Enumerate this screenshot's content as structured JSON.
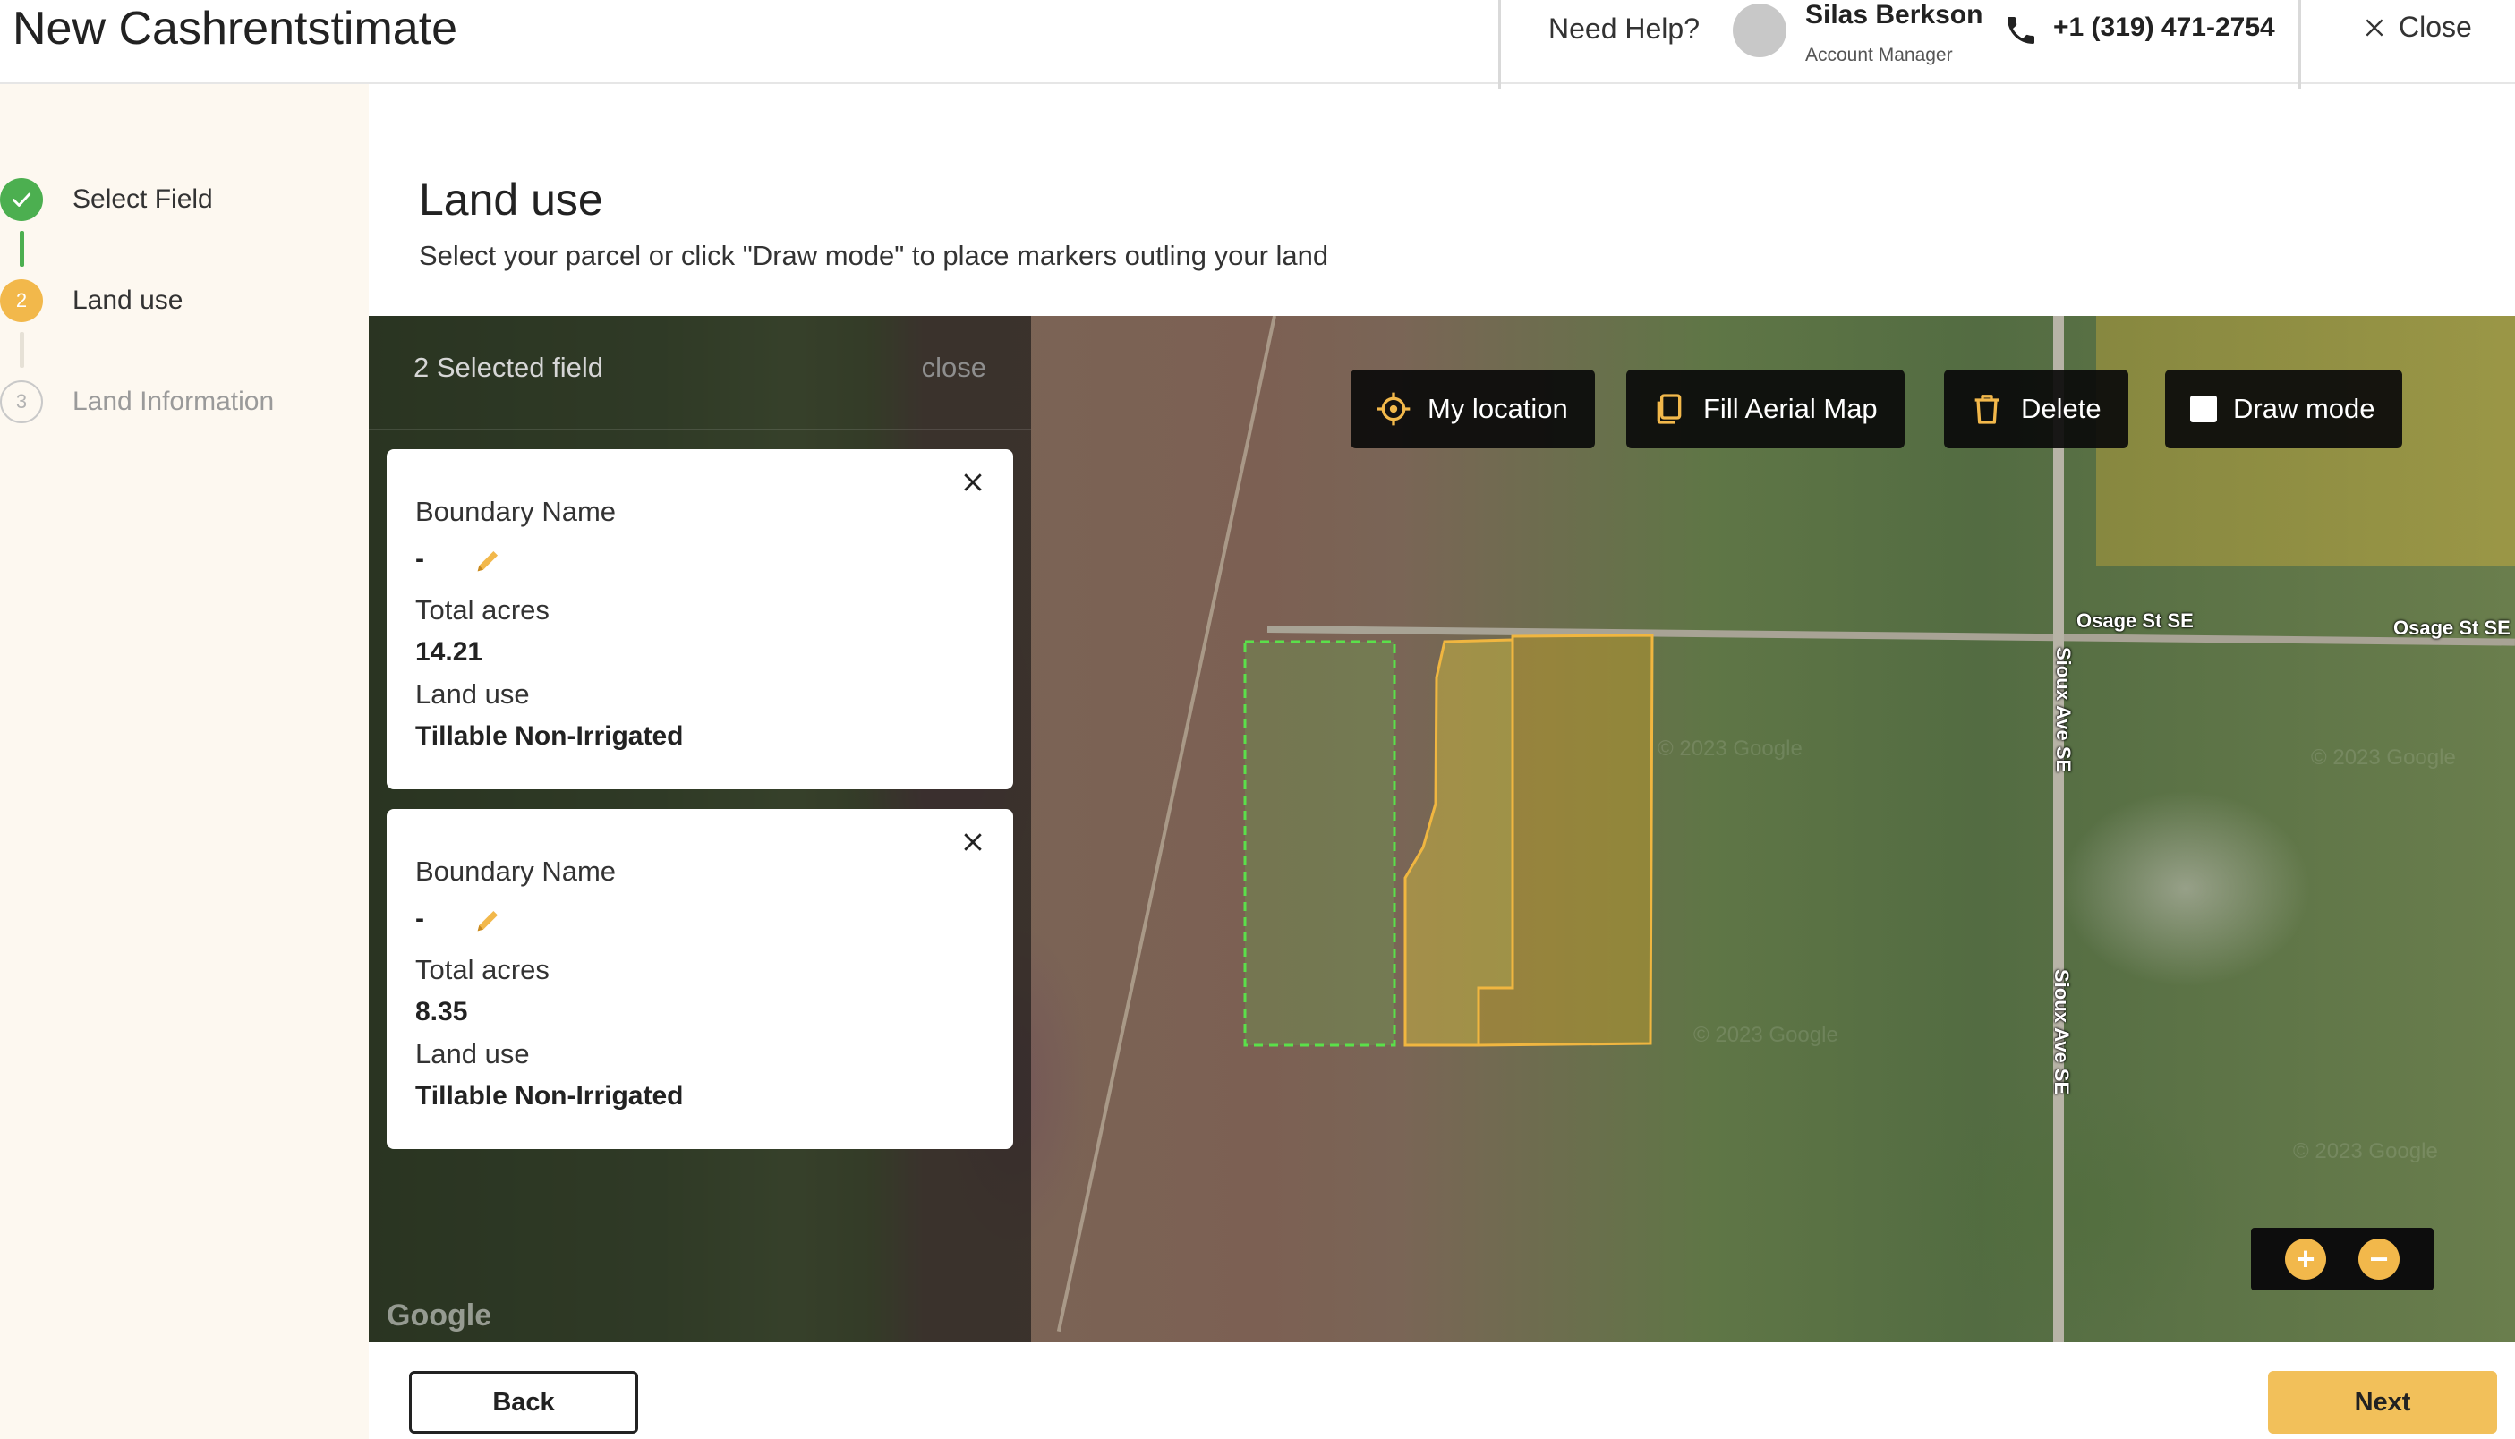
{
  "app": {
    "title": "New Cashrentstimate"
  },
  "header": {
    "help_text": "Need Help?",
    "manager_name": "Silas Berkson",
    "manager_role": "Account Manager",
    "phone": "+1 (319) 471-2754",
    "close_label": "Close"
  },
  "steps": [
    {
      "number": "1",
      "label": "Select Field",
      "state": "done"
    },
    {
      "number": "2",
      "label": "Land use",
      "state": "active"
    },
    {
      "number": "3",
      "label": "Land Information",
      "state": "todo"
    }
  ],
  "page": {
    "title": "Land use",
    "subtitle": "Select your parcel or click \"Draw mode\" to place markers outling your land"
  },
  "panel": {
    "count_label": "2 Selected field",
    "close_label": "close",
    "fields": [
      {
        "name_label": "Boundary Name",
        "name_value": "-",
        "acres_label": "Total acres",
        "acres_value": "14.21",
        "use_label": "Land use",
        "use_value": "Tillable Non-Irrigated"
      },
      {
        "name_label": "Boundary Name",
        "name_value": "-",
        "acres_label": "Total acres",
        "acres_value": "8.35",
        "use_label": "Land use",
        "use_value": "Tillable Non-Irrigated"
      }
    ]
  },
  "map_toolbar": {
    "my_location": "My location",
    "fill_aerial": "Fill Aerial Map",
    "delete": "Delete",
    "draw_mode": "Draw mode",
    "draw_mode_checked": false
  },
  "map": {
    "roads": [
      "Osage St SE",
      "Osage St SE",
      "Sioux Ave SE",
      "Sioux Ave SE"
    ],
    "attribution": "Google",
    "watermark": "© 2023 Google"
  },
  "zoom": {
    "in": "+",
    "out": "−"
  },
  "footer": {
    "back_label": "Back",
    "next_label": "Next"
  },
  "colors": {
    "accent": "#f2b84b",
    "success": "#4caf50",
    "boundary_yellow": "#f0b640",
    "boundary_green": "#5be04a"
  },
  "icons": [
    "check-icon",
    "phone-icon",
    "close-icon",
    "crosshair-icon",
    "copy-icon",
    "trash-icon",
    "pencil-icon"
  ]
}
